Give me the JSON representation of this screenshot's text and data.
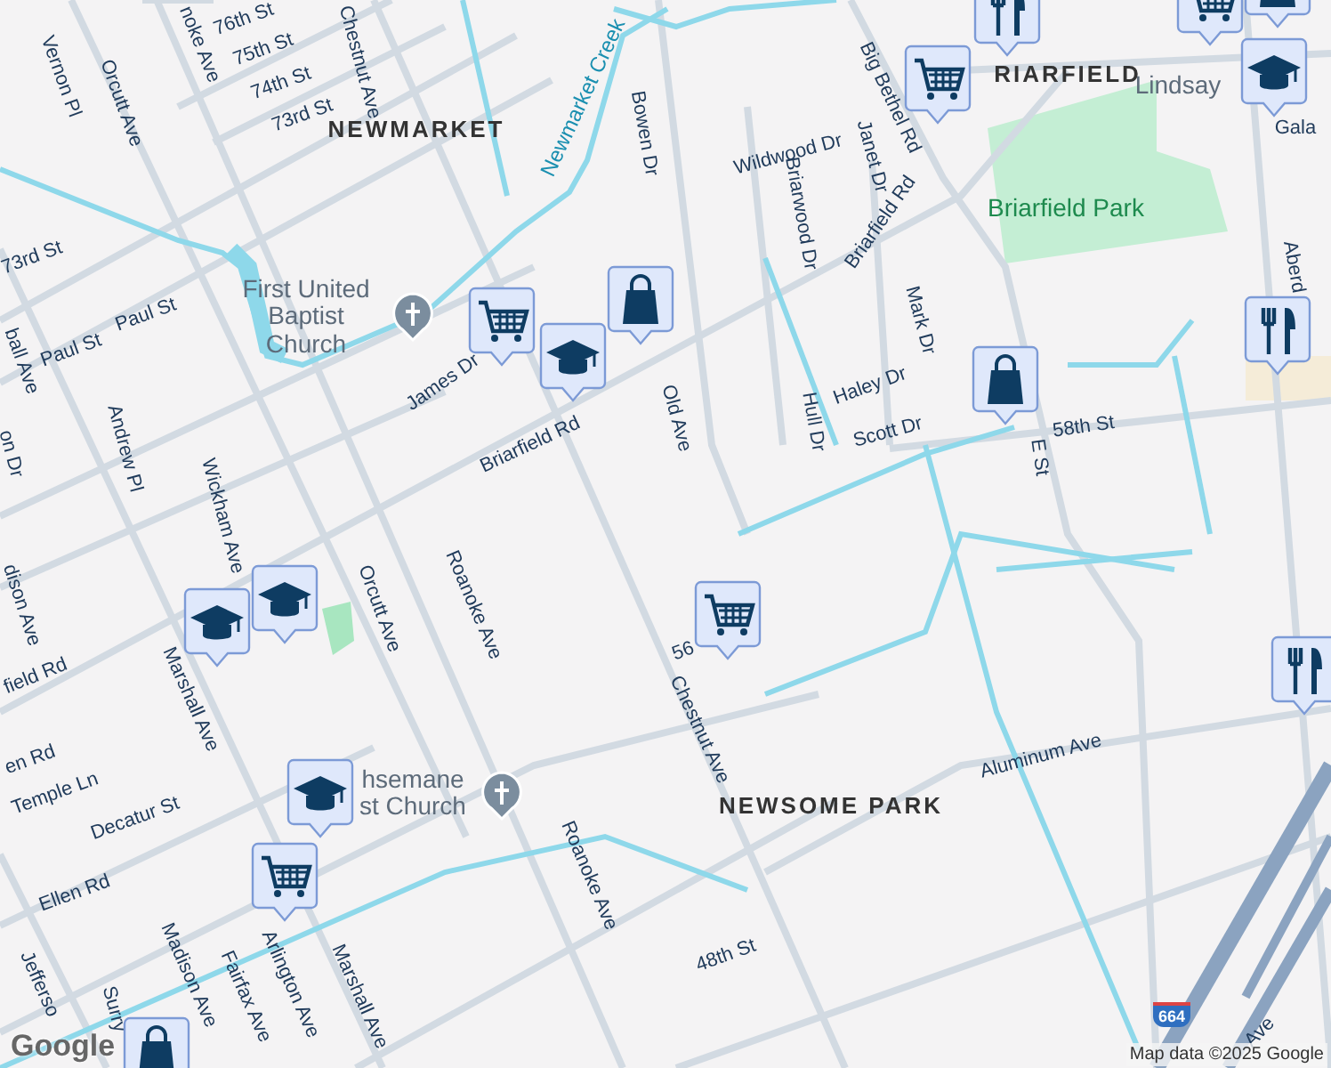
{
  "map": {
    "labels": [
      {
        "text": "noke Ave",
        "kind": "street"
      },
      {
        "text": "76th St",
        "kind": "street"
      },
      {
        "text": "75th St",
        "kind": "street"
      },
      {
        "text": "74th St",
        "kind": "street"
      },
      {
        "text": "73rd St",
        "kind": "street"
      },
      {
        "text": "Chestnut Ave",
        "kind": "street"
      },
      {
        "text": "Vernon Pl",
        "kind": "street"
      },
      {
        "text": "Orcutt Ave",
        "kind": "street"
      },
      {
        "text": "NEWMARKET",
        "kind": "area"
      },
      {
        "text": "Newmarket Creek",
        "kind": "water"
      },
      {
        "text": "Bowen Dr",
        "kind": "street"
      },
      {
        "text": "Wildwood Dr",
        "kind": "street"
      },
      {
        "text": "Briarwood Dr",
        "kind": "street"
      },
      {
        "text": "Janet Dr",
        "kind": "street"
      },
      {
        "text": "Big Bethel Rd",
        "kind": "street"
      },
      {
        "text": "RIARFIELD",
        "kind": "area"
      },
      {
        "text": "Lindsay",
        "kind": "poi"
      },
      {
        "text": "Gala",
        "kind": "street"
      },
      {
        "text": "Briarfield Park",
        "kind": "park"
      },
      {
        "text": "Briarfield Rd",
        "kind": "street"
      },
      {
        "text": "73rd St",
        "kind": "street"
      },
      {
        "text": "ball Ave",
        "kind": "street"
      },
      {
        "text": "Paul St",
        "kind": "street"
      },
      {
        "text": "Paul St",
        "kind": "street"
      },
      {
        "text": "First United Baptist Church",
        "kind": "poi"
      },
      {
        "text": "James Dr",
        "kind": "street"
      },
      {
        "text": "Old Ave",
        "kind": "street"
      },
      {
        "text": "Mark Dr",
        "kind": "street"
      },
      {
        "text": "Haley Dr",
        "kind": "street"
      },
      {
        "text": "Hull Dr",
        "kind": "street"
      },
      {
        "text": "Scott Dr",
        "kind": "street"
      },
      {
        "text": "58th St",
        "kind": "street"
      },
      {
        "text": "E St",
        "kind": "street"
      },
      {
        "text": "Aberd",
        "kind": "street"
      },
      {
        "text": "on Dr",
        "kind": "street"
      },
      {
        "text": "Andrew Pl",
        "kind": "street"
      },
      {
        "text": "Wickham Ave",
        "kind": "street"
      },
      {
        "text": "Briarfield Rd",
        "kind": "street"
      },
      {
        "text": "dison Ave",
        "kind": "street"
      },
      {
        "text": "field Rd",
        "kind": "street"
      },
      {
        "text": "Orcutt Ave",
        "kind": "street"
      },
      {
        "text": "Roanoke Ave",
        "kind": "street"
      },
      {
        "text": "56",
        "kind": "street"
      },
      {
        "text": "Marshall Ave",
        "kind": "street"
      },
      {
        "text": "Chestnut Ave",
        "kind": "street"
      },
      {
        "text": "en Rd",
        "kind": "street"
      },
      {
        "text": "Temple Ln",
        "kind": "street"
      },
      {
        "text": "Decatur St",
        "kind": "street"
      },
      {
        "text": "hsemane st Church",
        "kind": "poi"
      },
      {
        "text": "Roanoke Ave",
        "kind": "street"
      },
      {
        "text": "NEWSOME PARK",
        "kind": "area"
      },
      {
        "text": "Aluminum Ave",
        "kind": "street"
      },
      {
        "text": "Ellen Rd",
        "kind": "street"
      },
      {
        "text": "Arlington Ave",
        "kind": "street"
      },
      {
        "text": "Fairfax Ave",
        "kind": "street"
      },
      {
        "text": "Madison Ave",
        "kind": "street"
      },
      {
        "text": "Surry",
        "kind": "street"
      },
      {
        "text": "Jefferso",
        "kind": "street"
      },
      {
        "text": "Marshall Ave",
        "kind": "street"
      },
      {
        "text": "48th St",
        "kind": "street"
      },
      {
        "text": "Ave",
        "kind": "street"
      }
    ],
    "highway_shield": "664",
    "logo": "Google",
    "attribution": "Map data ©2025 Google"
  }
}
